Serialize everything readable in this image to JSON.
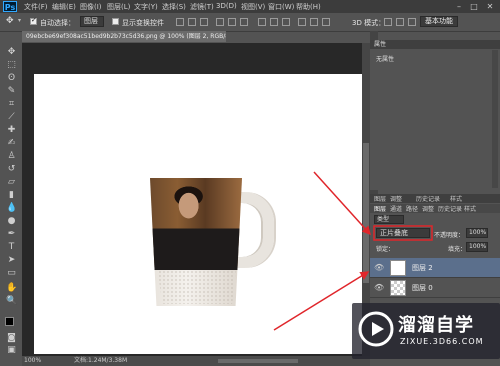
{
  "app": {
    "logo": "Ps"
  },
  "menu": [
    "文件(F)",
    "编辑(E)",
    "图像(I)",
    "图层(L)",
    "文字(Y)",
    "选择(S)",
    "滤镜(T)",
    "3D(D)",
    "视图(V)",
    "窗口(W)",
    "帮助(H)"
  ],
  "options_bar": {
    "auto_select_label": "自动选择：",
    "auto_select_value": "图层",
    "show_transform_label": "显示变换控件",
    "mode_3d_label": "3D 模式：",
    "workspace": "基本功能"
  },
  "document": {
    "tab_title": "09ebcbe69ef308ac51bed9b2b73c5d36.png @ 100% (图层 2, RGB/8) *",
    "zoom": "100%",
    "doc_info": "文档:1.24M/3.38M"
  },
  "properties_panel": {
    "title": "属性",
    "empty_text": "无属性"
  },
  "layers_panel": {
    "tabs": [
      "图层",
      "通道",
      "路径",
      "调整",
      "历史记录",
      "样式"
    ],
    "top_tabs": [
      "图层",
      "调整",
      "历史记录",
      "样式"
    ],
    "kind_filter": "类型",
    "blend_mode": "正片叠底",
    "opacity_label": "不透明度：",
    "opacity_value": "100%",
    "lock_label": "锁定：",
    "fill_label": "填充：",
    "fill_value": "100%",
    "layers": [
      {
        "name": "图层 2",
        "selected": true
      },
      {
        "name": "图层 0",
        "selected": false
      }
    ]
  },
  "watermark": {
    "brand": "溜溜自学",
    "url": "ZIXUE.3D66.COM"
  },
  "colors": {
    "accent_red": "#e0262b",
    "selected_layer": "#5b6f8c",
    "ps_blue": "#31a8ff"
  }
}
